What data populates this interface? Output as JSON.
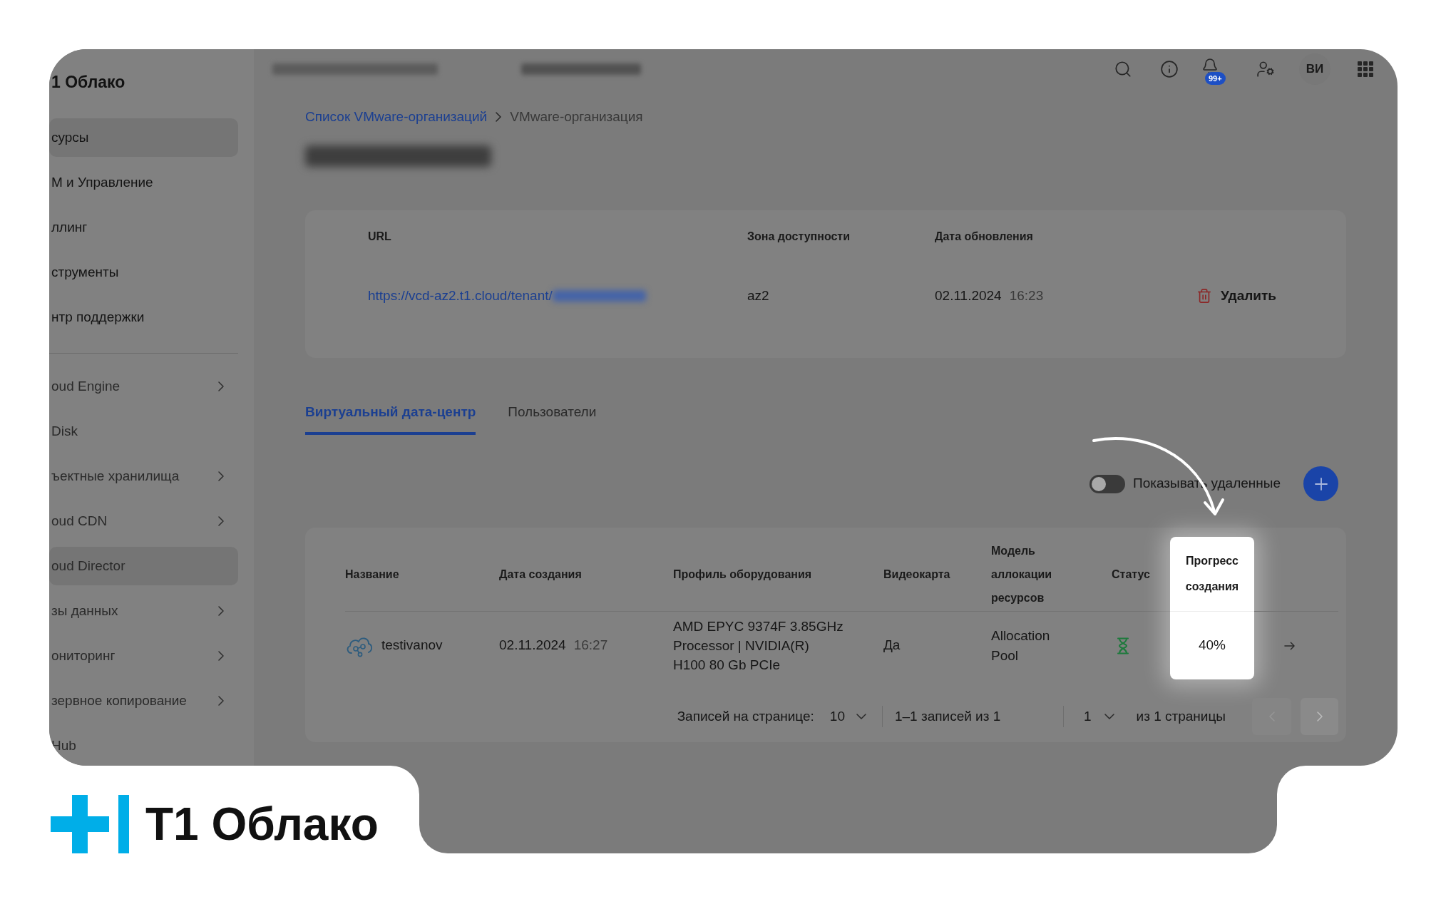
{
  "sidebar": {
    "title": "1 Облако",
    "primary_items": [
      {
        "label": "сурсы",
        "selected": true,
        "expandable": false
      },
      {
        "label": "М и Управление",
        "selected": false,
        "expandable": false
      },
      {
        "label": "ллинг",
        "selected": false,
        "expandable": false
      },
      {
        "label": "струменты",
        "selected": false,
        "expandable": false
      },
      {
        "label": "нтр поддержки",
        "selected": false,
        "expandable": false
      }
    ],
    "service_items": [
      {
        "label": "oud Engine",
        "selected": false,
        "expandable": true
      },
      {
        "label": "Disk",
        "selected": false,
        "expandable": false
      },
      {
        "label": "ъектные хранилища",
        "selected": false,
        "expandable": true
      },
      {
        "label": "oud CDN",
        "selected": false,
        "expandable": true
      },
      {
        "label": "oud Director",
        "selected": true,
        "expandable": false
      },
      {
        "label": "зы данных",
        "selected": false,
        "expandable": true
      },
      {
        "label": "ониторинг",
        "selected": false,
        "expandable": true
      },
      {
        "label": "зервное копирование",
        "selected": false,
        "expandable": true
      },
      {
        "label": "Hub",
        "selected": false,
        "expandable": false
      }
    ]
  },
  "top_bar": {
    "notification_count": "99+",
    "user_initials": "ВИ"
  },
  "breadcrumb": [
    {
      "label": "Список VMware-организаций",
      "kind": "link"
    },
    {
      "label": "VMware-организация",
      "kind": "current"
    }
  ],
  "details": {
    "columns": [
      "URL",
      "Зона доступности",
      "Дата обновления"
    ],
    "url": "https://vcd-az2.t1.cloud/tenant/",
    "zone": "az2",
    "updated_date": "02.11.2024",
    "updated_time": "16:23",
    "delete_label": "Удалить"
  },
  "tabs": [
    {
      "label": "Виртуальный дата-центр",
      "selected": true
    },
    {
      "label": "Пользователи",
      "selected": false
    }
  ],
  "show_deleted": {
    "label": "Показывать удаленные",
    "on": false
  },
  "table": {
    "columns": [
      {
        "label": "Название",
        "highlighted": false
      },
      {
        "label": "Дата создания",
        "highlighted": false
      },
      {
        "label": "Профиль оборудования",
        "highlighted": false
      },
      {
        "label": "Видеокарта",
        "highlighted": false
      },
      {
        "label": "Модель аллокации ресурсов",
        "highlighted": false
      },
      {
        "label": "Статус",
        "highlighted": false
      },
      {
        "label": "Прогресс создания",
        "highlighted": true
      }
    ],
    "rows": [
      {
        "name": "testivanov",
        "created_date": "02.11.2024",
        "created_time": "16:27",
        "hardware_profile": [
          "AMD EPYC 9374F 3.85GHz",
          "Processor | NVIDIA(R)",
          "H100 80 Gb PCIe"
        ],
        "gpu": "Да",
        "allocation_model": "Allocation Pool",
        "in_progress": true,
        "progress": "40%"
      }
    ]
  },
  "pagination": {
    "per_page_label": "Записей на странице:",
    "per_page": "10",
    "range": "1–1 записей из 1",
    "page": "1",
    "pages_label": "из 1 страницы",
    "prev": {
      "disabled": true
    },
    "next": {
      "disabled": false
    }
  },
  "brand": {
    "text": "T1 Облако"
  }
}
